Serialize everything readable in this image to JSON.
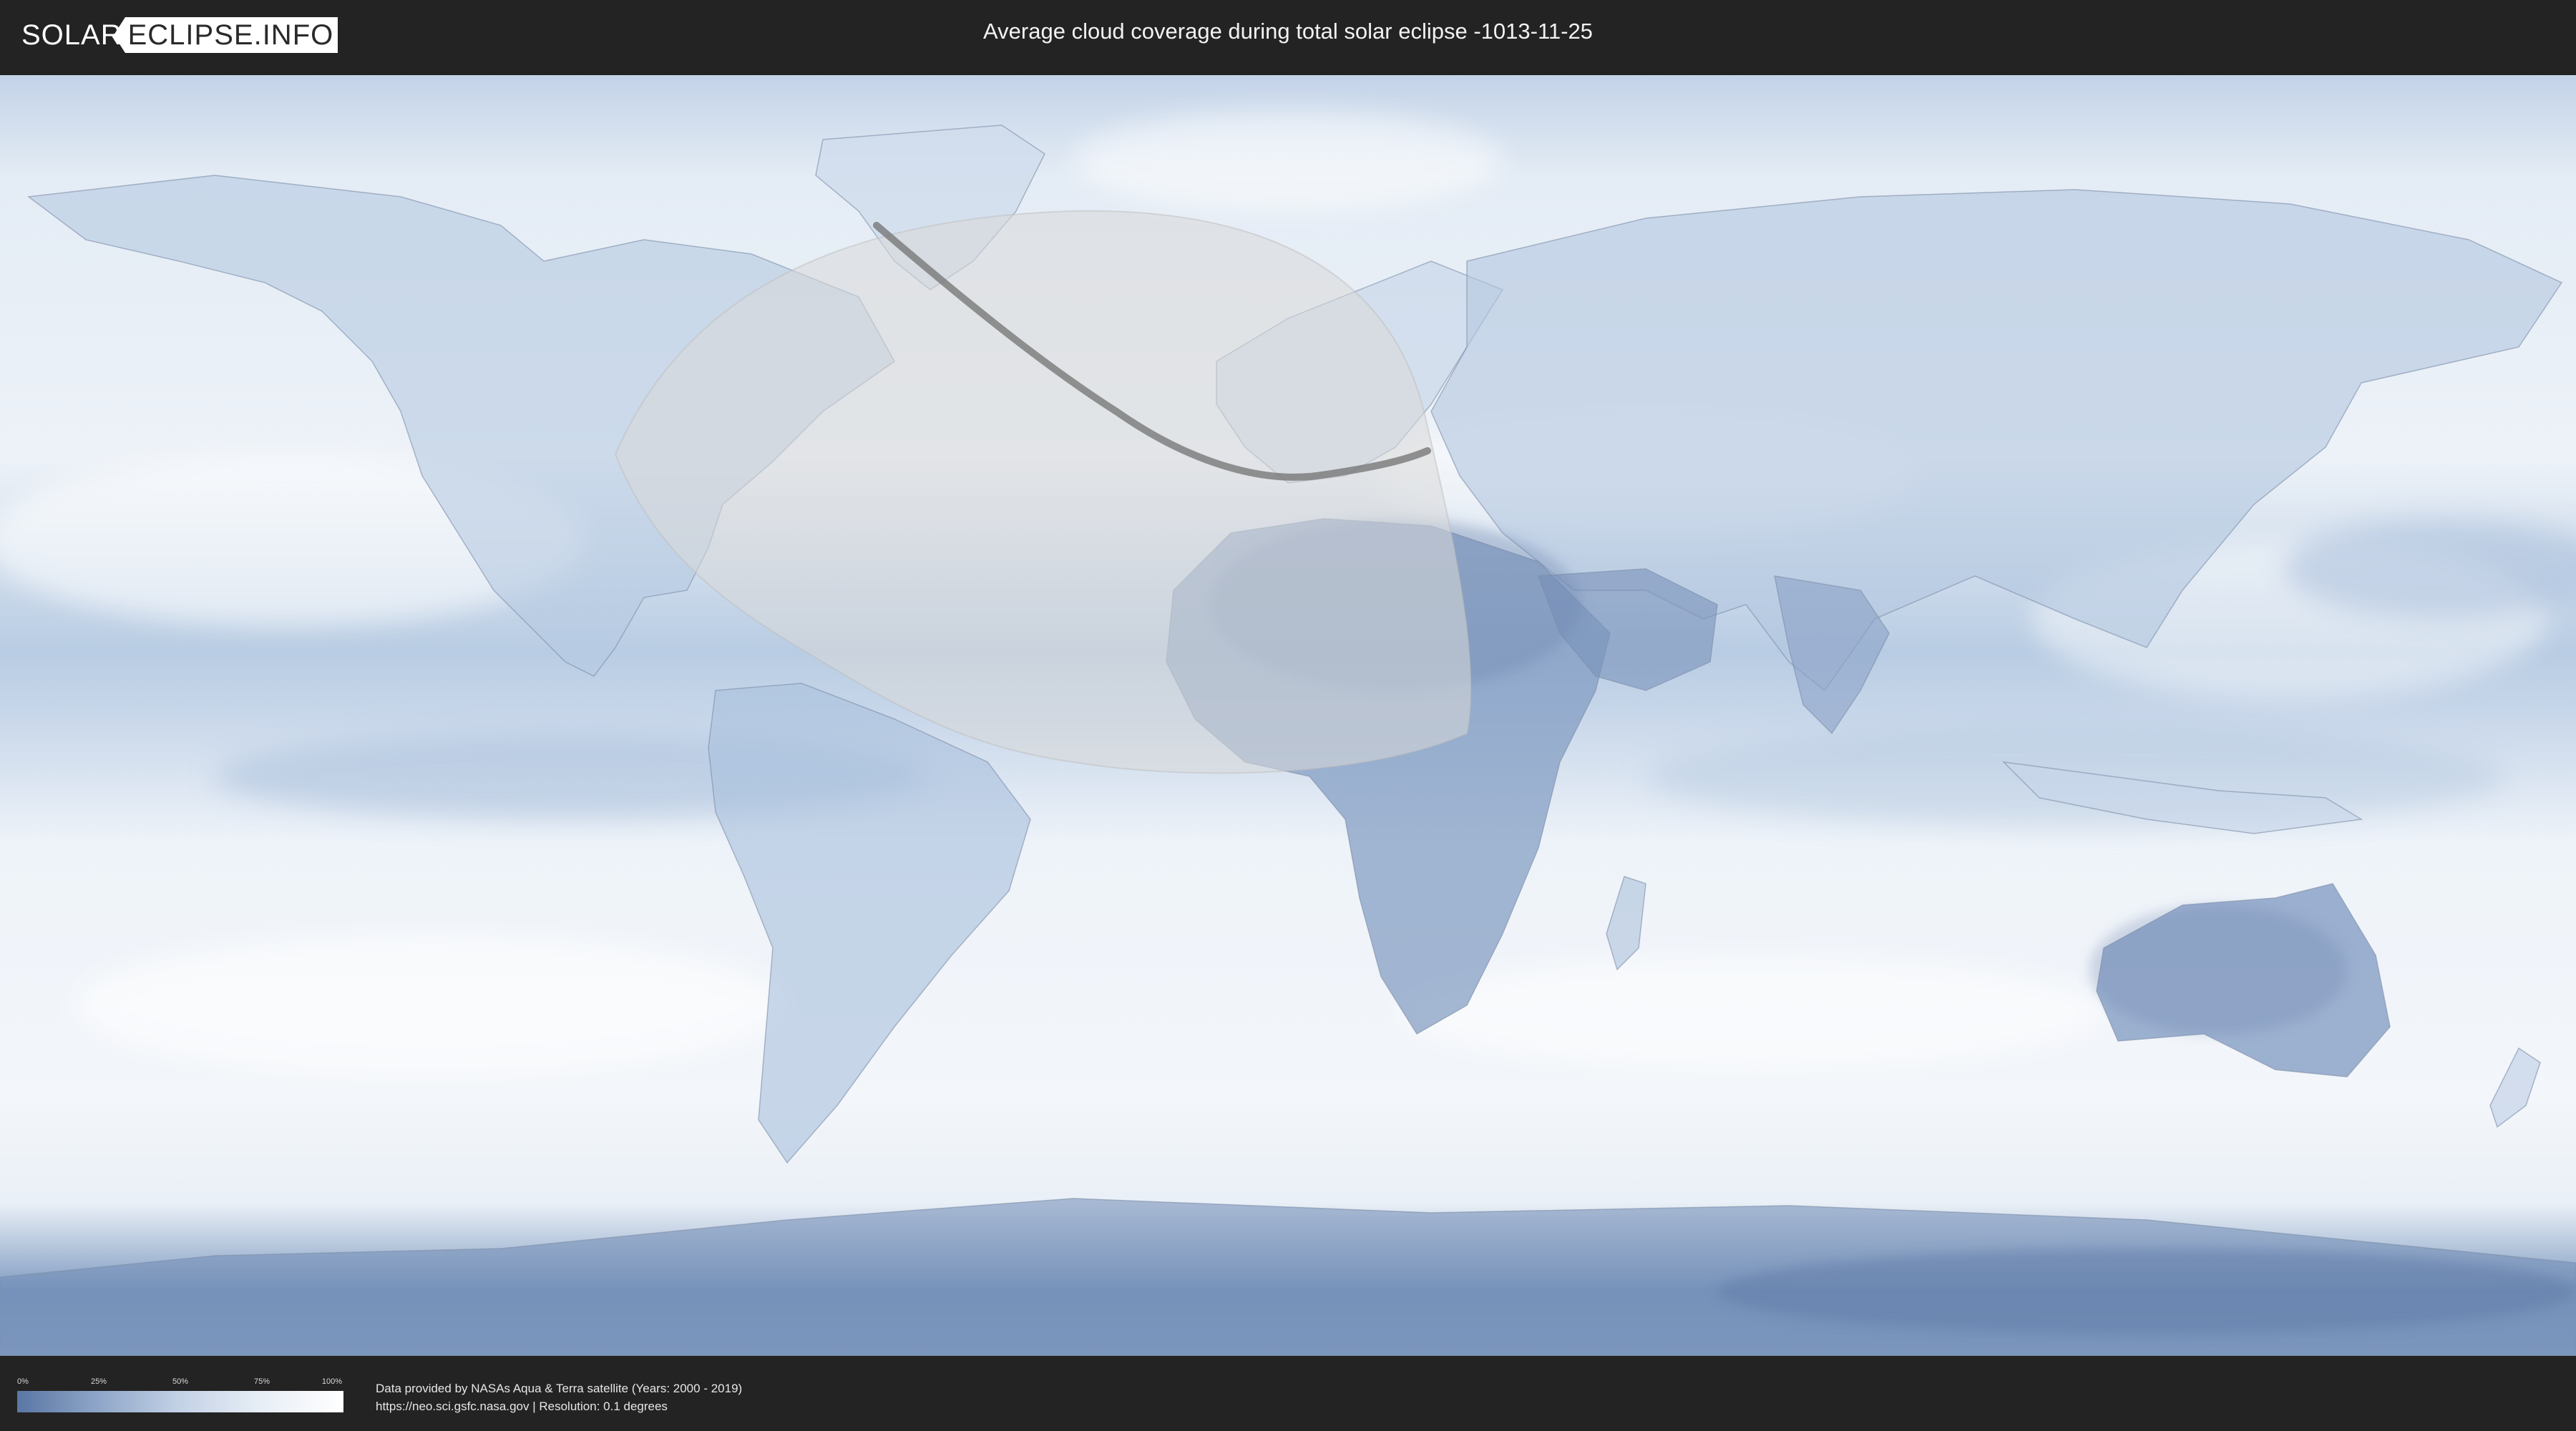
{
  "header": {
    "logo_part1": "SOLAR",
    "logo_part2": "ECLIPSE.INFO",
    "title": "Average cloud coverage during total solar eclipse -1013-11-25"
  },
  "legend": {
    "ticks": [
      "0%",
      "25%",
      "50%",
      "75%",
      "100%"
    ],
    "colors": {
      "low": "#5a76a4",
      "high": "#ffffff"
    }
  },
  "credits": {
    "line1": "Data provided by NASAs Aqua & Terra satellite (Years: 2000 - 2019)",
    "line2": "https://neo.sci.gsfc.nasa.gov | Resolution: 0.1 degrees"
  },
  "map": {
    "projection": "equirectangular",
    "eclipse_path_color": "#707070",
    "visibility_area_color": "#d9d9d9"
  }
}
